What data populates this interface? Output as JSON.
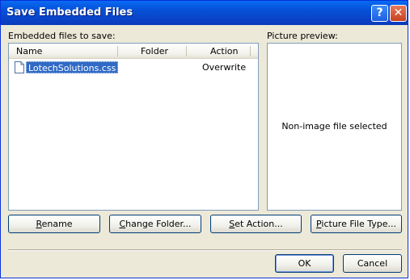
{
  "window": {
    "title": "Save Embedded Files",
    "help_label": "?",
    "close_label": "✕"
  },
  "left_panel": {
    "label": "Embedded files to save:",
    "columns": [
      "Name",
      "Folder",
      "Action"
    ],
    "files": [
      {
        "name": "LotechSolutions.css",
        "folder": "",
        "action": "Overwrite",
        "icon": "document-icon"
      }
    ]
  },
  "right_panel": {
    "label": "Picture preview:",
    "message": "Non-image file selected"
  },
  "buttons": {
    "rename": {
      "before": "",
      "mnemonic": "R",
      "after": "ename"
    },
    "change_folder": {
      "before": "",
      "mnemonic": "C",
      "after": "hange Folder..."
    },
    "set_action": {
      "before": "",
      "mnemonic": "S",
      "after": "et Action..."
    },
    "picture_file_type": {
      "before": "",
      "mnemonic": "P",
      "after": "icture File Type..."
    },
    "ok": "OK",
    "cancel": "Cancel"
  }
}
